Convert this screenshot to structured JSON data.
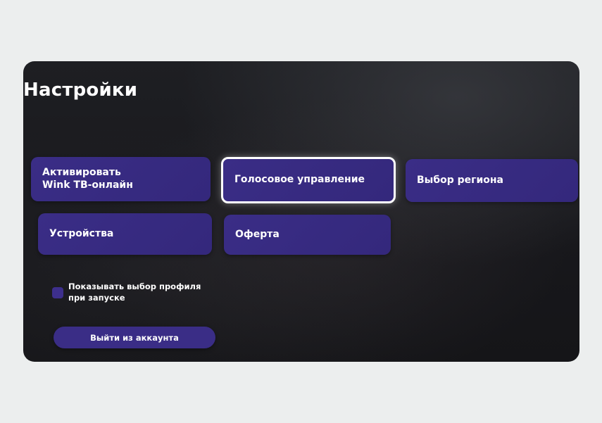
{
  "settings": {
    "title": "Настройки",
    "tiles": [
      {
        "label_line1": "Активировать",
        "label_line2": "Wink ТВ-онлайн"
      },
      {
        "label": "Голосовое управление"
      },
      {
        "label": "Выбор региона"
      },
      {
        "label": "Устройства"
      },
      {
        "label": "Оферта"
      }
    ],
    "show_profile_choice": {
      "label": "Показывать выбор профиля при запуске",
      "checked": false
    },
    "logout_label": "Выйти из аккаунта"
  },
  "colors": {
    "tile_background": "#3a2d86",
    "focus_border": "#ffffff",
    "screen_background": "#18181c",
    "page_background": "#eceeee"
  }
}
